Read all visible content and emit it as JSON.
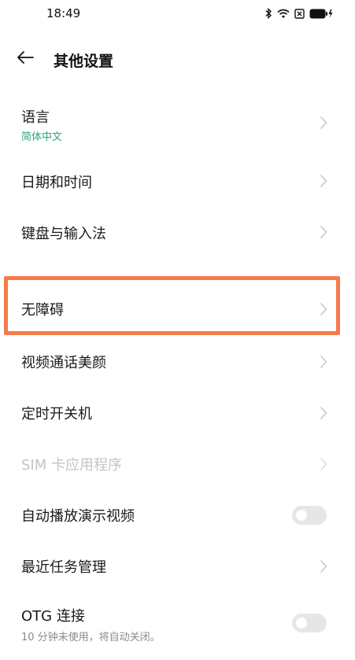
{
  "status_bar": {
    "time": "18:49",
    "icons": [
      "bluetooth-icon",
      "wifi-icon",
      "sim-x-icon",
      "battery-charging-icon"
    ]
  },
  "header": {
    "title": "其他设置",
    "back_icon": "back-arrow-icon"
  },
  "colors": {
    "accent_green": "#2aa876",
    "highlight": "#f47a4c",
    "chevron": "#c8c8c8",
    "disabled_text": "#c4c4c4"
  },
  "settings": {
    "language": {
      "title": "语言",
      "subtitle": "简体中文"
    },
    "date_time": {
      "title": "日期和时间"
    },
    "keyboard": {
      "title": "键盘与输入法"
    },
    "accessibility": {
      "title": "无障碍"
    },
    "video_call_beauty": {
      "title": "视频通话美颜"
    },
    "scheduled_power": {
      "title": "定时开关机"
    },
    "sim_toolkit": {
      "title": "SIM 卡应用程序",
      "disabled": true
    },
    "demo_video": {
      "title": "自动播放演示视频",
      "toggle": false
    },
    "recent_tasks": {
      "title": "最近任务管理"
    },
    "otg": {
      "title": "OTG 连接",
      "subtitle": "10 分钟未使用，将自动关闭。",
      "toggle": false
    }
  }
}
